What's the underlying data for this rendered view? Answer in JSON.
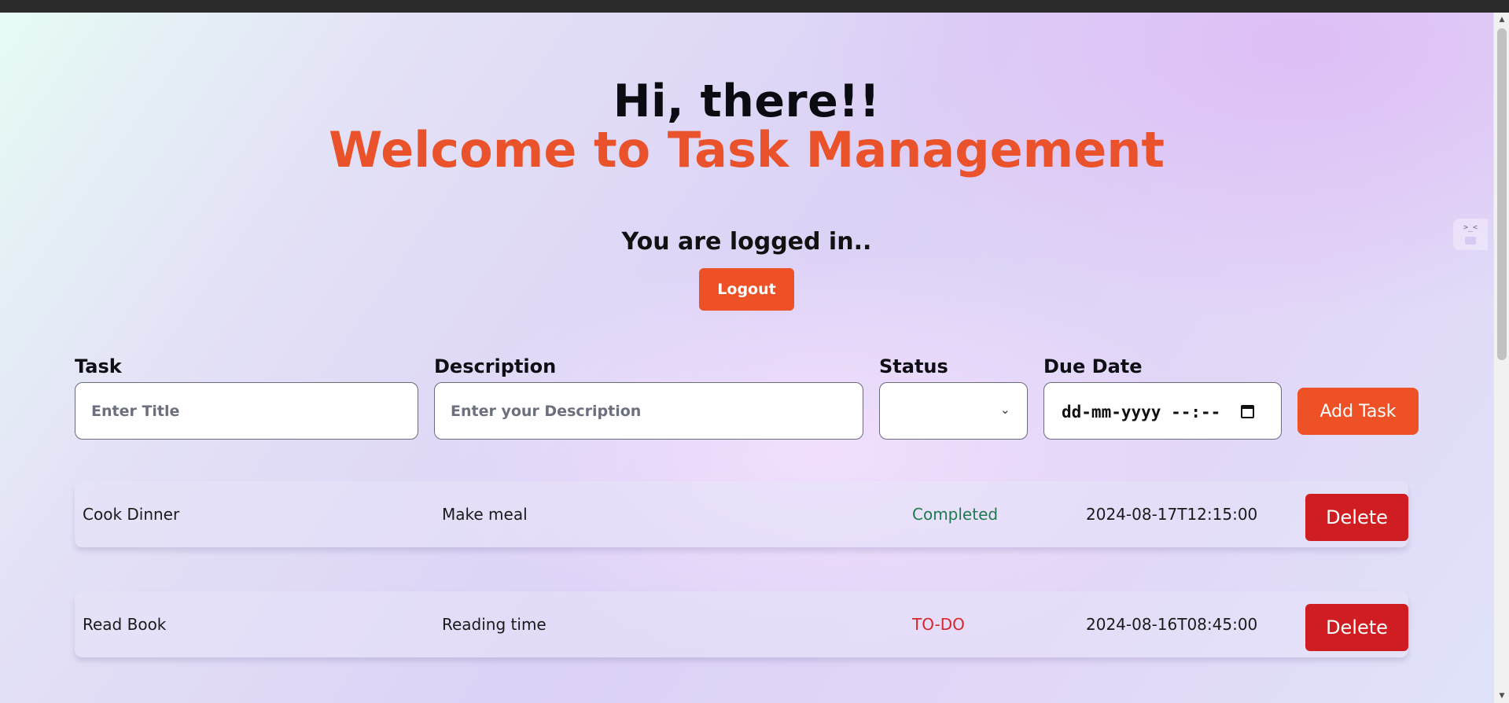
{
  "header": {
    "greeting": "Hi, there!!",
    "welcome": "Welcome to Task Management",
    "status_message": "You are logged in..",
    "logout_label": "Logout"
  },
  "form": {
    "task_label": "Task",
    "task_placeholder": "Enter Title",
    "description_label": "Description",
    "description_placeholder": "Enter your Description",
    "status_label": "Status",
    "status_value": "",
    "due_date_label": "Due Date",
    "due_date_placeholder": "dd-mm-yyyy --:--",
    "add_label": "Add Task"
  },
  "tasks": [
    {
      "title": "Cook Dinner",
      "description": "Make meal",
      "status": "Completed",
      "status_color": "#1f7a4f",
      "due": "2024-08-17T12:15:00",
      "delete_label": "Delete"
    },
    {
      "title": "Read Book",
      "description": "Reading time",
      "status": "TO-DO",
      "status_color": "#d7262b",
      "due": "2024-08-16T08:45:00",
      "delete_label": "Delete"
    }
  ],
  "colors": {
    "accent": "#ed5125",
    "danger": "#cf1d21"
  }
}
